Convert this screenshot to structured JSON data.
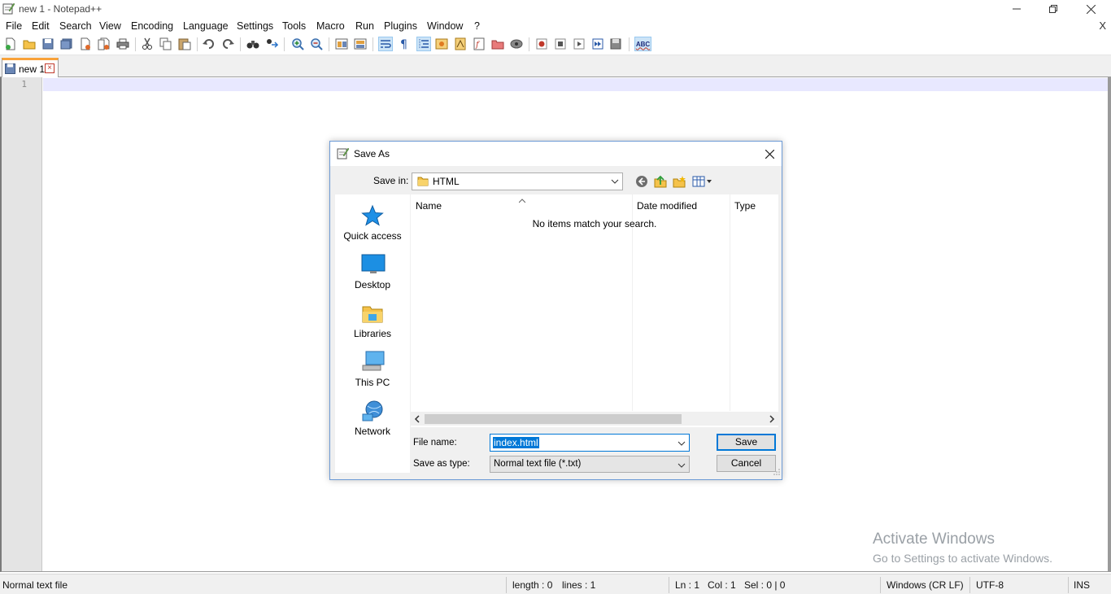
{
  "window": {
    "title": "new 1 - Notepad++"
  },
  "menu": {
    "items": [
      "File",
      "Edit",
      "Search",
      "View",
      "Encoding",
      "Language",
      "Settings",
      "Tools",
      "Macro",
      "Run",
      "Plugins",
      "Window",
      "?"
    ],
    "close_doc": "X"
  },
  "toolbar": {
    "spellcheck_label": "ABC"
  },
  "tabs": [
    {
      "label": "new 1",
      "active": true
    }
  ],
  "editor": {
    "line_numbers": [
      "1"
    ]
  },
  "watermark": {
    "line1": "Activate Windows",
    "line2": "Go to Settings to activate Windows."
  },
  "statusbar": {
    "file_type": "Normal text file",
    "length": "length : 0",
    "lines": "lines : 1",
    "ln": "Ln : 1",
    "col": "Col : 1",
    "sel": "Sel : 0 | 0",
    "eol": "Windows (CR LF)",
    "encoding": "UTF-8",
    "mode": "INS"
  },
  "dialog": {
    "title": "Save As",
    "save_in_label": "Save in:",
    "save_in_value": "HTML",
    "places": [
      {
        "label": "Quick access",
        "icon": "star-icon"
      },
      {
        "label": "Desktop",
        "icon": "desktop-icon"
      },
      {
        "label": "Libraries",
        "icon": "libraries-icon"
      },
      {
        "label": "This PC",
        "icon": "computer-icon"
      },
      {
        "label": "Network",
        "icon": "network-icon"
      }
    ],
    "columns": [
      "Name",
      "Date modified",
      "Type"
    ],
    "empty_message": "No items match your search.",
    "file_name_label": "File name:",
    "file_name_value": "index.html",
    "save_type_label": "Save as type:",
    "save_type_value": "Normal text file (*.txt)",
    "save_button": "Save",
    "cancel_button": "Cancel"
  },
  "colors": {
    "accent": "#0078d7",
    "tab_highlight": "#f9a23a",
    "current_line": "#e8e8ff"
  }
}
